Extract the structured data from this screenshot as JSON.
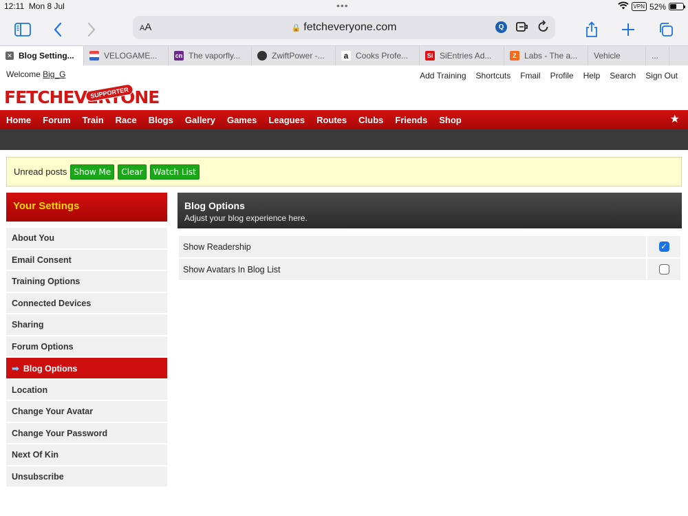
{
  "status_bar": {
    "time": "12:11",
    "date": "Mon 8 Jul",
    "vpn": "VPN",
    "battery": "52%"
  },
  "browser": {
    "text_size_label": "AA",
    "url": "fetcheveryone.com",
    "tabs": [
      {
        "title": "Blog Setting...",
        "active": true,
        "favicon": "close-icon"
      },
      {
        "title": "VELOGAME...",
        "favicon": "flag-favicon"
      },
      {
        "title": "The vaporfly...",
        "favicon": "cn-favicon"
      },
      {
        "title": "ZwiftPower -...",
        "favicon": "zwift-favicon"
      },
      {
        "title": "Cooks Profe...",
        "favicon": "amazon-favicon"
      },
      {
        "title": "SiEntries Ad...",
        "favicon": "si-favicon"
      },
      {
        "title": "Labs - The a...",
        "favicon": "labs-favicon"
      },
      {
        "title": "Vehicle",
        "favicon": ""
      },
      {
        "title": "...",
        "favicon": ""
      }
    ]
  },
  "site": {
    "welcome_prefix": "Welcome",
    "username": "Big_G",
    "top_links": [
      "Add Training",
      "Shortcuts",
      "Fmail",
      "Profile",
      "Help",
      "Search",
      "Sign Out"
    ],
    "logo_text": "FETCHEVERYONE",
    "logo_badge": "SUPPORTER",
    "nav": [
      "Home",
      "Forum",
      "Train",
      "Race",
      "Blogs",
      "Gallery",
      "Games",
      "Leagues",
      "Routes",
      "Clubs",
      "Friends",
      "Shop"
    ],
    "unread": {
      "label": "Unread posts",
      "buttons": [
        "Show Me",
        "Clear",
        "Watch List"
      ]
    }
  },
  "settings": {
    "title": "Your Settings",
    "items": [
      "About You",
      "Email Consent",
      "Training Options",
      "Connected Devices",
      "Sharing",
      "Forum Options",
      "Blog Options",
      "Location",
      "Change Your Avatar",
      "Change Your Password",
      "Next Of Kin",
      "Unsubscribe"
    ],
    "active_index": 6
  },
  "panel": {
    "title": "Blog Options",
    "subtitle": "Adjust your blog experience here.",
    "options": [
      {
        "label": "Show Readership",
        "checked": true
      },
      {
        "label": "Show Avatars In Blog List",
        "checked": false
      }
    ]
  },
  "colors": {
    "brand_red": "#d11616",
    "nav_dark": "#3a3a3a",
    "button_green": "#1aa81a",
    "link_blue": "#1a73e8",
    "settings_title": "#ffd700"
  }
}
